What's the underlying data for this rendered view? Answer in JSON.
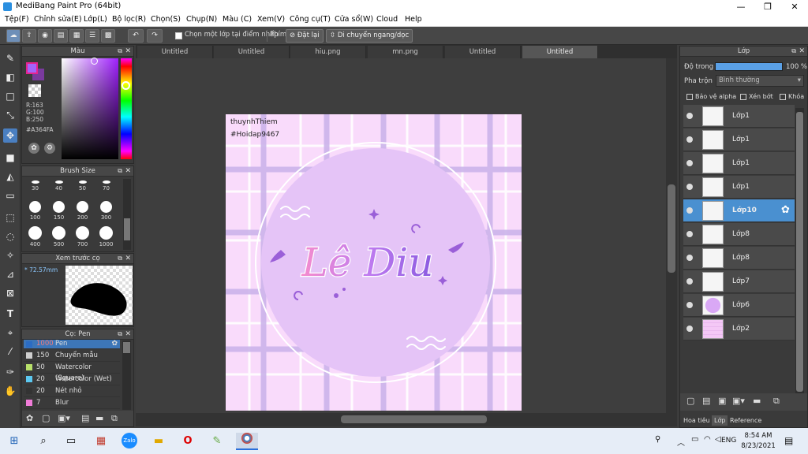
{
  "window": {
    "title": "MediBang Paint Pro (64bit)",
    "controls": [
      "—",
      "❐",
      "✕"
    ]
  },
  "menu": [
    "Tệp(F)",
    "Chỉnh sửa(E)",
    "Lớp(L)",
    "Bộ lọc(R)",
    "Chọn(S)",
    "Chụp(N)",
    "Màu (C)",
    "Xem(V)",
    "Công cụ(T)",
    "Cửa sổ(W)",
    "Cloud",
    "Help"
  ],
  "toolbar": {
    "select_layer_checkbox": "Chọn một lớp tại điểm nhấp",
    "key_label": "Phím",
    "reset_button": "Đặt lại",
    "move_button": "Di chuyển ngang/dọc"
  },
  "color_panel": {
    "title": "Màu",
    "r": "R:163",
    "g": "G:100",
    "b": "B:250",
    "hex": "#A364FA",
    "fg_color": "#A364FA"
  },
  "brush_size_panel": {
    "title": "Brush Size",
    "sizes": [
      "30",
      "40",
      "50",
      "70",
      "100",
      "150",
      "200",
      "300",
      "400",
      "500",
      "700",
      "1000"
    ]
  },
  "preview_panel": {
    "title": "Xem trước cọ",
    "size": "72.57mm"
  },
  "brush_panel": {
    "title": "Cọ: Pen",
    "items": [
      {
        "size": "1000",
        "name": "Pen",
        "color": "#2b6cc4"
      },
      {
        "size": "150",
        "name": "Chuyển mẫu",
        "color": "#cfcfcf"
      },
      {
        "size": "50",
        "name": "Watercolor (Square)",
        "color": "#b8e06a"
      },
      {
        "size": "20",
        "name": "Watercolor (Wet)",
        "color": "#5cc8f0"
      },
      {
        "size": "20",
        "name": "Nét nhỏ",
        "color": "#333333"
      },
      {
        "size": "7",
        "name": "Blur",
        "color": "#f07cd8"
      }
    ]
  },
  "doc_tabs": [
    "Untitled",
    "Untitled",
    "hiu.png",
    "mn.png",
    "Untitled",
    "Untitled"
  ],
  "canvas_text": {
    "credit_line1": "thuynhThiem",
    "credit_line2": "#Hoidap9467",
    "main_text": "Lê Diu"
  },
  "layer_panel": {
    "title": "Lớp",
    "opacity_label": "Độ trong",
    "opacity_value": "100 %",
    "opacity": 1.0,
    "blend_label": "Pha trộn",
    "blend_value": "Bình thường",
    "protect_alpha": "Bảo vệ alpha",
    "clip": "Xén bớt",
    "lock": "Khóa",
    "layers": [
      "Lớp1",
      "Lớp1",
      "Lớp1",
      "Lớp1",
      "Lớp10",
      "Lớp8",
      "Lớp8",
      "Lớp7",
      "Lớp6",
      "Lớp2"
    ],
    "selected_index": 4,
    "bottom_tabs": [
      "Hoa tiêu",
      "Lớp",
      "Reference"
    ]
  },
  "taskbar": {
    "time": "8:54 AM",
    "date": "8/23/2021",
    "lang": "ENG"
  }
}
